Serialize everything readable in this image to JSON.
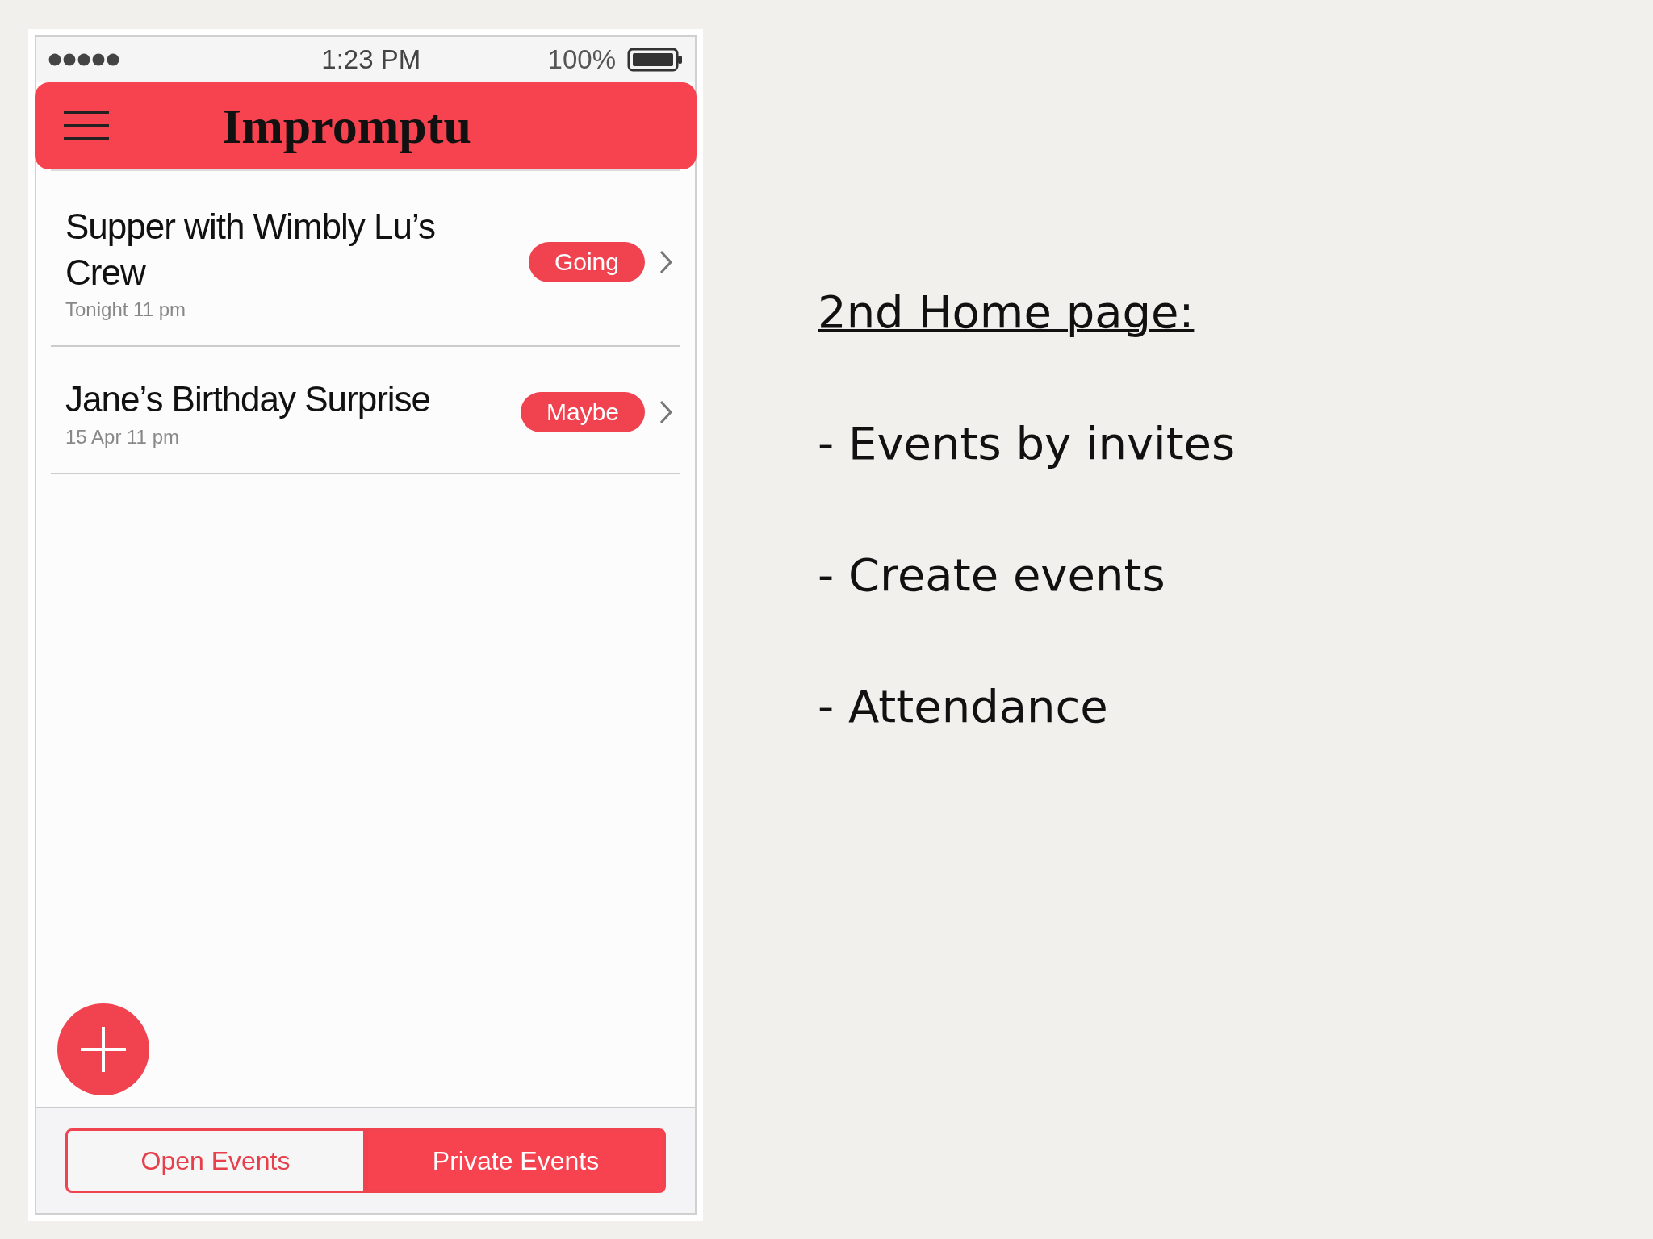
{
  "status_bar": {
    "time": "1:23 PM",
    "battery": "100%"
  },
  "header": {
    "title": "Impromptu"
  },
  "events": [
    {
      "title": "Supper with Wimbly Lu’s Crew",
      "when": "Tonight 11 pm",
      "status": "Going"
    },
    {
      "title": "Jane’s Birthday Surprise",
      "when": "15 Apr 11 pm",
      "status": "Maybe"
    }
  ],
  "segments": [
    {
      "label": "Open Events",
      "selected": false
    },
    {
      "label": "Private Events",
      "selected": true
    }
  ],
  "notes": {
    "heading": "2nd Home page:",
    "bullets": [
      "- Events by invites",
      "- Create events",
      "- Attendance"
    ]
  }
}
